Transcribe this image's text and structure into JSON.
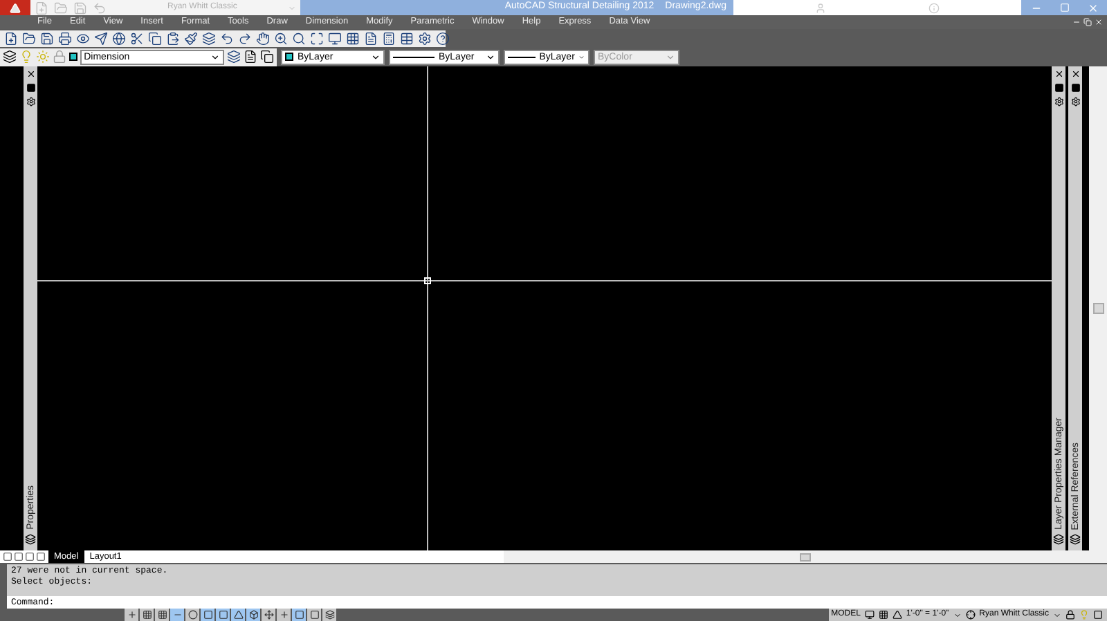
{
  "title_bar": {
    "workspace": "Ryan Whitt Classic",
    "app_title": "AutoCAD Structural Detailing 2012",
    "file_name": "Drawing2.dwg"
  },
  "menu": [
    "File",
    "Edit",
    "View",
    "Insert",
    "Format",
    "Tools",
    "Draw",
    "Dimension",
    "Modify",
    "Parametric",
    "Window",
    "Help",
    "Express",
    "Data View"
  ],
  "properties_bar": {
    "layer": "Dimension",
    "color_setting": "ByLayer",
    "linetype": "ByLayer",
    "lineweight": "ByLayer",
    "plot_style": {
      "value": "ByColor",
      "disabled": true
    }
  },
  "left_palettes": [
    {
      "label": "Properties"
    }
  ],
  "right_palettes": [
    {
      "label": "Layer Properties Manager"
    },
    {
      "label": "External References"
    }
  ],
  "layout_tabs": [
    {
      "label": "Model",
      "selected": true
    },
    {
      "label": "Layout1",
      "selected": false
    }
  ],
  "command_history": [
    "27 were not in current space.",
    "Select objects:"
  ],
  "command_prompt": "Command:",
  "status_toggles": [
    {
      "on": false
    },
    {
      "on": false
    },
    {
      "on": false
    },
    {
      "on": true
    },
    {
      "on": false
    },
    {
      "on": true
    },
    {
      "on": true
    },
    {
      "on": true
    },
    {
      "on": true
    },
    {
      "on": false
    },
    {
      "on": false
    },
    {
      "on": true
    },
    {
      "on": false
    },
    {
      "on": false
    }
  ],
  "status_right": {
    "space": "MODEL",
    "scale": "1'-0\" = 1'-0\"",
    "workspace": "Ryan Whitt Classic"
  }
}
